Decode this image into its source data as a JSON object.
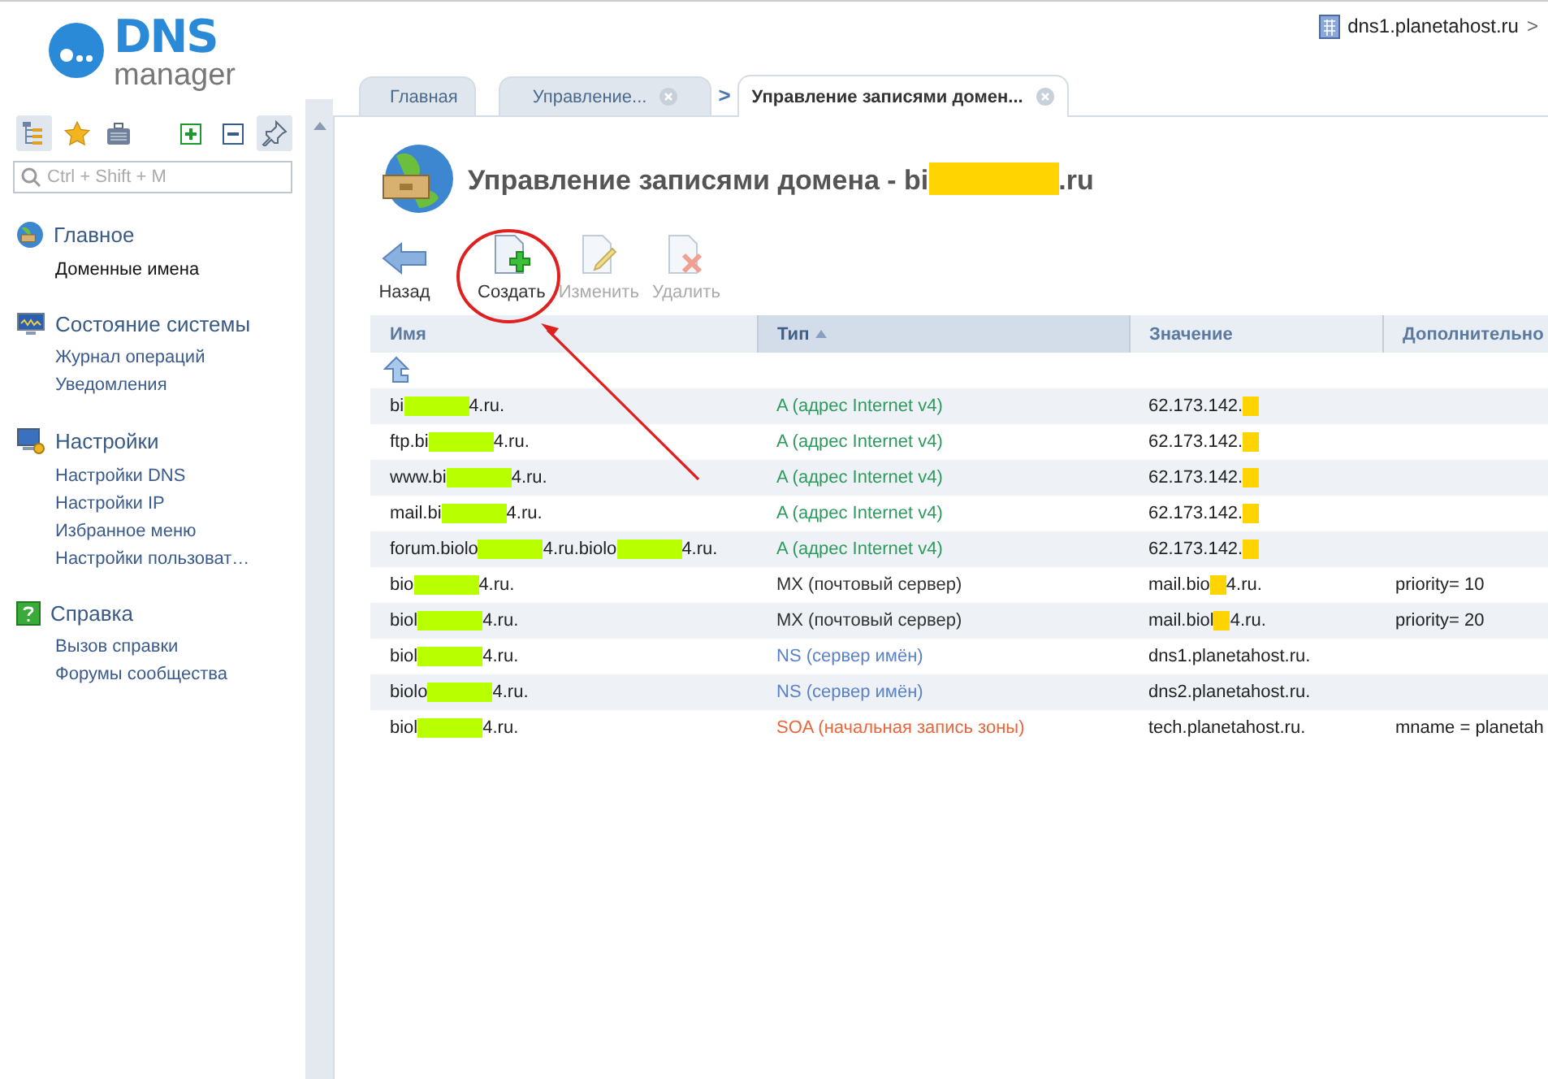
{
  "header": {
    "logo": {
      "title": "DNS",
      "subtitle": "manager"
    },
    "server": {
      "label": "dns1.planetahost.ru",
      "arrow": ">"
    }
  },
  "sidebar": {
    "tools": [
      {
        "kind": "tree",
        "selected": true
      },
      {
        "kind": "star",
        "selected": false
      },
      {
        "kind": "case",
        "selected": false
      },
      {
        "kind": "expand",
        "selected": false
      },
      {
        "kind": "collapse",
        "selected": false
      },
      {
        "kind": "pin",
        "selected": true
      }
    ],
    "search": {
      "placeholder": "Ctrl + Shift + M"
    },
    "groups": [
      {
        "title": "Главное",
        "kind": "globe",
        "items": [
          {
            "label": "Доменные имена",
            "selected": true
          }
        ]
      },
      {
        "title": "Состояние системы",
        "kind": "monitor",
        "items": [
          {
            "label": "Журнал операций",
            "selected": false
          },
          {
            "label": "Уведомления",
            "selected": false
          }
        ]
      },
      {
        "title": "Настройки",
        "kind": "settings",
        "items": [
          {
            "label": "Настройки DNS",
            "selected": false
          },
          {
            "label": "Настройки IP",
            "selected": false
          },
          {
            "label": "Избранное меню",
            "selected": false
          },
          {
            "label": "Настройки пользоват…",
            "selected": false
          }
        ]
      },
      {
        "title": "Справка",
        "kind": "help",
        "items": [
          {
            "label": "Вызов справки",
            "selected": false
          },
          {
            "label": "Форумы сообщества",
            "selected": false
          }
        ]
      }
    ]
  },
  "tabs": [
    {
      "label": "Главная",
      "selected": false,
      "closable": false
    },
    {
      "label": "Управление...",
      "selected": false,
      "closable": true,
      "separator_after": ">"
    },
    {
      "label": "Управление записями домен...",
      "selected": true,
      "closable": true
    }
  ],
  "page": {
    "title": [
      {
        "text": "Управление записями домена - bi"
      },
      {
        "kind": "marker",
        "color": "#ffd400"
      },
      {
        "text": ".ru"
      }
    ],
    "toolbar": [
      {
        "kind": "back",
        "label": "Назад",
        "disabled": false
      },
      {
        "kind": "create",
        "label": "Создать",
        "disabled": false
      },
      {
        "kind": "edit",
        "label": "Изменить",
        "disabled": true
      },
      {
        "kind": "delete",
        "label": "Удалить",
        "disabled": true
      }
    ],
    "annotation": {
      "color": "#e02020"
    },
    "table": {
      "columns": [
        {
          "label": "Имя",
          "sorted": false
        },
        {
          "label": "Тип",
          "sorted": true
        },
        {
          "label": "Значение",
          "sorted": false
        },
        {
          "label": "Дополнительно",
          "sorted": false
        }
      ],
      "rows": [
        {
          "name": [
            {
              "text": "bi"
            },
            {
              "kind": "marker",
              "color": "#b8ff00"
            },
            {
              "text": "4.ru."
            }
          ],
          "kind": "A",
          "type": "A (адрес Internet v4)",
          "value": [
            {
              "text": "62.173.142."
            },
            {
              "kind": "marker",
              "color": "#ffd400"
            }
          ],
          "extra": ""
        },
        {
          "name": [
            {
              "text": "ftp.bi"
            },
            {
              "kind": "marker",
              "color": "#b8ff00"
            },
            {
              "text": "4.ru."
            }
          ],
          "kind": "A",
          "type": "A (адрес Internet v4)",
          "value": [
            {
              "text": "62.173.142."
            },
            {
              "kind": "marker",
              "color": "#ffd400"
            }
          ],
          "extra": ""
        },
        {
          "name": [
            {
              "text": "www.bi"
            },
            {
              "kind": "marker",
              "color": "#b8ff00"
            },
            {
              "text": "4.ru."
            }
          ],
          "kind": "A",
          "type": "A (адрес Internet v4)",
          "value": [
            {
              "text": "62.173.142."
            },
            {
              "kind": "marker",
              "color": "#ffd400"
            }
          ],
          "extra": ""
        },
        {
          "name": [
            {
              "text": "mail.bi"
            },
            {
              "kind": "marker",
              "color": "#b8ff00"
            },
            {
              "text": "4.ru."
            }
          ],
          "kind": "A",
          "type": "A (адрес Internet v4)",
          "value": [
            {
              "text": "62.173.142."
            },
            {
              "kind": "marker",
              "color": "#ffd400"
            }
          ],
          "extra": ""
        },
        {
          "name": [
            {
              "text": "forum.biolo"
            },
            {
              "kind": "marker",
              "color": "#b8ff00"
            },
            {
              "text": "4.ru.biolo"
            },
            {
              "kind": "marker",
              "color": "#b8ff00"
            },
            {
              "text": "4.ru."
            }
          ],
          "kind": "A",
          "type": "A (адрес Internet v4)",
          "value": [
            {
              "text": "62.173.142."
            },
            {
              "kind": "marker",
              "color": "#ffd400"
            }
          ],
          "extra": ""
        },
        {
          "name": [
            {
              "text": "bio"
            },
            {
              "kind": "marker",
              "color": "#b8ff00"
            },
            {
              "text": "4.ru."
            }
          ],
          "kind": "MX",
          "type": "MX (почтовый сервер)",
          "value": [
            {
              "text": "mail.bio"
            },
            {
              "kind": "marker",
              "color": "#ffd400"
            },
            {
              "text": "4.ru."
            }
          ],
          "extra": "priority= 10"
        },
        {
          "name": [
            {
              "text": "biol"
            },
            {
              "kind": "marker",
              "color": "#b8ff00"
            },
            {
              "text": "4.ru."
            }
          ],
          "kind": "MX",
          "type": "MX (почтовый сервер)",
          "value": [
            {
              "text": "mail.biol"
            },
            {
              "kind": "marker",
              "color": "#ffd400"
            },
            {
              "text": "4.ru."
            }
          ],
          "extra": "priority= 20"
        },
        {
          "name": [
            {
              "text": "biol"
            },
            {
              "kind": "marker",
              "color": "#b8ff00"
            },
            {
              "text": "4.ru."
            }
          ],
          "kind": "NS",
          "type": "NS (сервер имён)",
          "value": [
            {
              "text": "dns1.planetahost.ru."
            }
          ],
          "extra": ""
        },
        {
          "name": [
            {
              "text": "biolo"
            },
            {
              "kind": "marker",
              "color": "#b8ff00"
            },
            {
              "text": "4.ru."
            }
          ],
          "kind": "NS",
          "type": "NS (сервер имён)",
          "value": [
            {
              "text": "dns2.planetahost.ru."
            }
          ],
          "extra": ""
        },
        {
          "name": [
            {
              "text": "biol"
            },
            {
              "kind": "marker",
              "color": "#b8ff00"
            },
            {
              "text": "4.ru."
            }
          ],
          "kind": "SOA",
          "type": "SOA (начальная запись зоны)",
          "value": [
            {
              "text": "tech.planetahost.ru."
            }
          ],
          "extra": "mname = planetah"
        }
      ]
    }
  }
}
